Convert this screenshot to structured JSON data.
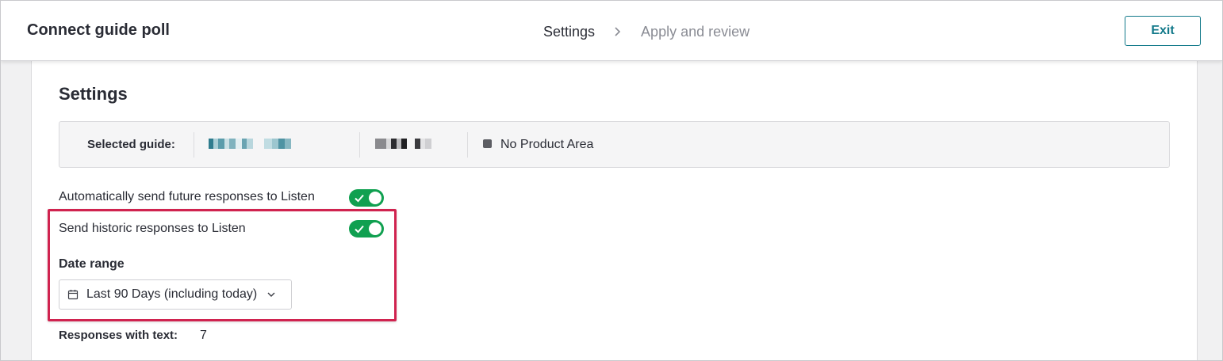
{
  "header": {
    "title": "Connect guide poll",
    "steps": [
      {
        "label": "Settings",
        "state": "current"
      },
      {
        "label": "Apply and review",
        "state": "upcoming"
      }
    ],
    "exit_label": "Exit"
  },
  "settings": {
    "title": "Settings",
    "selected_guide": {
      "label": "Selected guide:",
      "guide_name": "(pixelated / redacted)",
      "product_area_label": "No Product Area"
    },
    "auto_send": {
      "label": "Automatically send future responses to Listen",
      "enabled": true
    },
    "historic_send": {
      "label": "Send historic responses to Listen",
      "enabled": true
    },
    "date_range": {
      "label": "Date range",
      "value": "Last 90 Days (including today)"
    },
    "responses_with_text": {
      "label": "Responses with text:",
      "value": "7"
    }
  },
  "icons": {
    "step_separator": "chevron-right-icon",
    "calendar": "calendar-icon",
    "dropdown": "chevron-down-icon",
    "toggle_on": "check-icon"
  },
  "colors": {
    "accent": "#12798a",
    "toggle_on": "#10a050",
    "highlight": "#d0234f",
    "product_area_swatch": "#5c5d63"
  }
}
